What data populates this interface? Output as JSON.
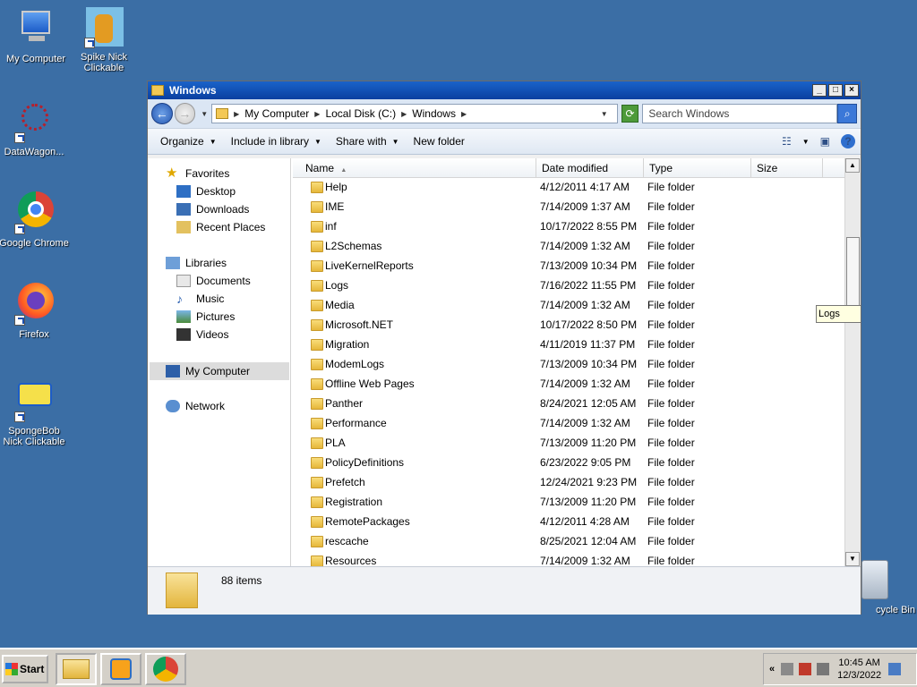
{
  "desktop": {
    "icons": [
      {
        "label": "My Computer",
        "icon": "computer-icon"
      },
      {
        "label": "Spike Nick Clickable",
        "icon": "spike-icon"
      },
      {
        "label": "DataWagon...",
        "icon": "datawagon-icon"
      },
      {
        "label": "Google Chrome",
        "icon": "chrome-icon"
      },
      {
        "label": "Firefox",
        "icon": "firefox-icon"
      },
      {
        "label": "SpongeBob Nick Clickable",
        "icon": "spongebob-icon"
      },
      {
        "label": "cycle Bin",
        "icon": "recycle-bin-icon"
      }
    ]
  },
  "window": {
    "title": "Windows",
    "address": {
      "crumbs": [
        "My Computer",
        "Local Disk (C:)",
        "Windows"
      ]
    },
    "search_placeholder": "Search Windows",
    "toolbar": {
      "organize": "Organize",
      "include": "Include in library",
      "share": "Share with",
      "new_folder": "New folder"
    },
    "nav": {
      "favorites": "Favorites",
      "desktop": "Desktop",
      "downloads": "Downloads",
      "recent": "Recent Places",
      "libraries": "Libraries",
      "documents": "Documents",
      "music": "Music",
      "pictures": "Pictures",
      "videos": "Videos",
      "my_computer": "My Computer",
      "network": "Network"
    },
    "columns": {
      "name": "Name",
      "date": "Date modified",
      "type": "Type",
      "size": "Size"
    },
    "files": [
      {
        "name": "Help",
        "date": "4/12/2011 4:17 AM",
        "type": "File folder"
      },
      {
        "name": "IME",
        "date": "7/14/2009 1:37 AM",
        "type": "File folder"
      },
      {
        "name": "inf",
        "date": "10/17/2022 8:55 PM",
        "type": "File folder"
      },
      {
        "name": "L2Schemas",
        "date": "7/14/2009 1:32 AM",
        "type": "File folder"
      },
      {
        "name": "LiveKernelReports",
        "date": "7/13/2009 10:34 PM",
        "type": "File folder"
      },
      {
        "name": "Logs",
        "date": "7/16/2022 11:55 PM",
        "type": "File folder"
      },
      {
        "name": "Media",
        "date": "7/14/2009 1:32 AM",
        "type": "File folder"
      },
      {
        "name": "Microsoft.NET",
        "date": "10/17/2022 8:50 PM",
        "type": "File folder"
      },
      {
        "name": "Migration",
        "date": "4/11/2019 11:37 PM",
        "type": "File folder"
      },
      {
        "name": "ModemLogs",
        "date": "7/13/2009 10:34 PM",
        "type": "File folder"
      },
      {
        "name": "Offline Web Pages",
        "date": "7/14/2009 1:32 AM",
        "type": "File folder"
      },
      {
        "name": "Panther",
        "date": "8/24/2021 12:05 AM",
        "type": "File folder"
      },
      {
        "name": "Performance",
        "date": "7/14/2009 1:32 AM",
        "type": "File folder"
      },
      {
        "name": "PLA",
        "date": "7/13/2009 11:20 PM",
        "type": "File folder"
      },
      {
        "name": "PolicyDefinitions",
        "date": "6/23/2022 9:05 PM",
        "type": "File folder"
      },
      {
        "name": "Prefetch",
        "date": "12/24/2021 9:23 PM",
        "type": "File folder"
      },
      {
        "name": "Registration",
        "date": "7/13/2009 11:20 PM",
        "type": "File folder"
      },
      {
        "name": "RemotePackages",
        "date": "4/12/2011 4:28 AM",
        "type": "File folder"
      },
      {
        "name": "rescache",
        "date": "8/25/2021 12:04 AM",
        "type": "File folder"
      },
      {
        "name": "Resources",
        "date": "7/14/2009 1:32 AM",
        "type": "File folder"
      }
    ],
    "tooltip": "Logs",
    "status": "88 items"
  },
  "taskbar": {
    "start": "Start",
    "clock_time": "10:45 AM",
    "clock_date": "12/3/2022",
    "tray_expand": "«"
  }
}
